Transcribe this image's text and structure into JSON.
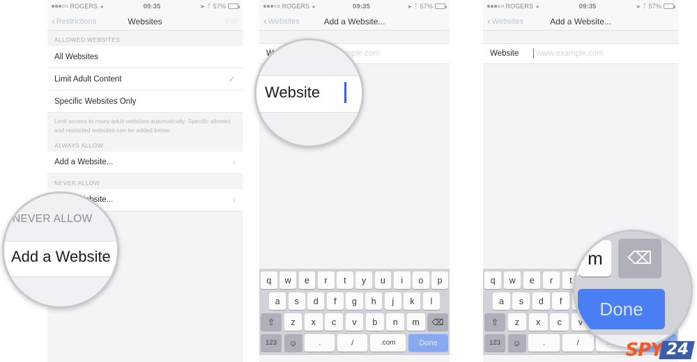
{
  "status_bar": {
    "carrier": "ROGERS",
    "signal_filled": 3,
    "signal_empty": 2,
    "wifi_icon": "wifi-icon",
    "time": "09:35",
    "location_icon": "location-arrow-icon",
    "bluetooth_icon": "bluetooth-icon",
    "battery_percent": "57%",
    "battery_level": 57
  },
  "panel1": {
    "nav": {
      "back_label": "Restrictions",
      "title": "Websites",
      "edit_label": "Edit"
    },
    "section1_header": "ALLOWED WEBSITES",
    "rows": [
      {
        "label": "All Websites",
        "accessory": "none"
      },
      {
        "label": "Limit Adult Content",
        "accessory": "check"
      },
      {
        "label": "Specific Websites Only",
        "accessory": "none"
      }
    ],
    "footnote": "Limit access to many adult websites automatically. Specific allowed and restricted websites can be added below.",
    "section2_header": "ALWAYS ALLOW",
    "always_allow_row": {
      "label": "Add a Website...",
      "accessory": "chevron"
    },
    "section3_header": "NEVER ALLOW",
    "never_allow_row": {
      "label": "Add a Website...",
      "accessory": "chevron"
    }
  },
  "panel2": {
    "nav": {
      "back_label": "Websites",
      "title": "Add a Website..."
    },
    "field": {
      "label": "Website",
      "placeholder": "www.example.com",
      "value": ""
    }
  },
  "panel3": {
    "nav": {
      "back_label": "Websites",
      "title": "Add a Website..."
    },
    "field": {
      "label": "Website",
      "placeholder": "www.example.com",
      "value": ""
    }
  },
  "keyboard": {
    "row1": [
      "q",
      "w",
      "e",
      "r",
      "t",
      "y",
      "u",
      "i",
      "o",
      "p"
    ],
    "row2": [
      "a",
      "s",
      "d",
      "f",
      "g",
      "h",
      "j",
      "k",
      "l"
    ],
    "row3": [
      "z",
      "x",
      "c",
      "v",
      "b",
      "n",
      "m"
    ],
    "shift_icon": "shift-icon",
    "backspace_icon": "backspace-icon",
    "numbers_label": "123",
    "emoji_icon": "emoji-icon",
    "period_label": ".",
    "slash_label": "/",
    "dotcom_label": ".com",
    "done_label": "Done"
  },
  "magnifier1": {
    "section_label": "NEVER ALLOW",
    "row_label": "Add a Website"
  },
  "magnifier2": {
    "field_label": "Website",
    "caret": "text-cursor"
  },
  "magnifier3": {
    "key_m": "m",
    "key_v": "v",
    "backspace_icon": "backspace-icon",
    "done_label": "Done"
  },
  "logo": {
    "text_primary": "SPY",
    "text_secondary": "24",
    "color_primary": "#f15a22",
    "color_secondary": "#3b5ca8"
  },
  "colors": {
    "ios_blue": "#3478f6",
    "done_button": "#4a7ef5",
    "keyboard_bg": "#d1d3d9",
    "list_bg": "#f4f4f7"
  }
}
